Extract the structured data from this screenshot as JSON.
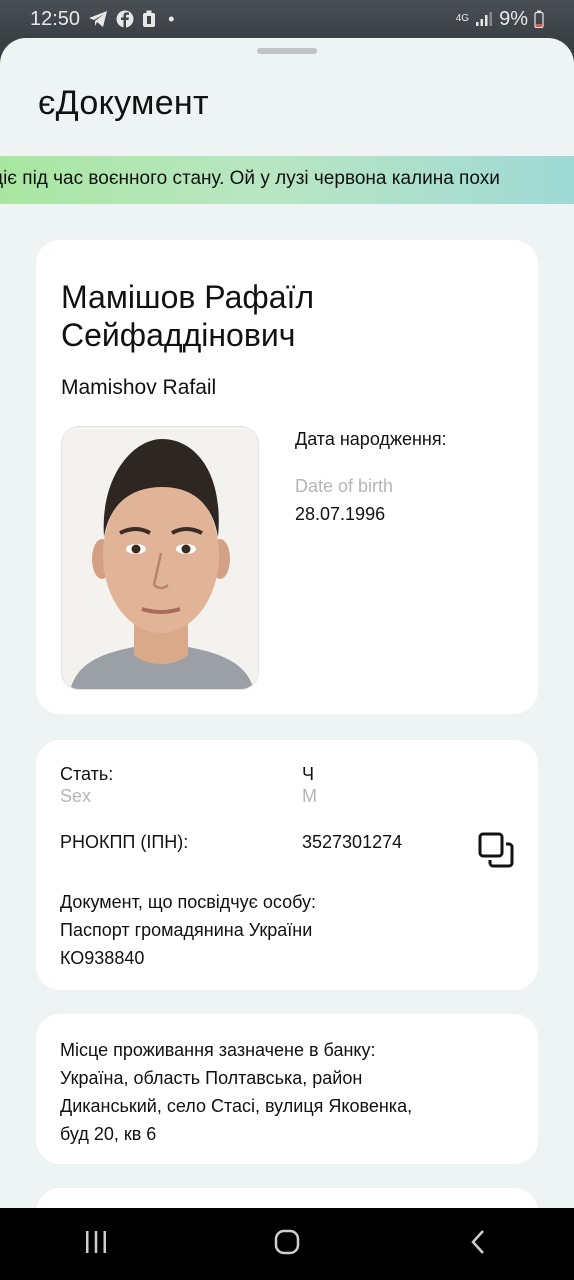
{
  "status": {
    "time": "12:50",
    "network": "4G",
    "battery": "9%"
  },
  "app": {
    "title": "єДокумент"
  },
  "ticker": {
    "text": "діє під час воєнного стану. Ой у лузі червона калина похи"
  },
  "person": {
    "name_ua": "Мамішов Рафаїл Сейфаддінович",
    "name_en": "Mamishov Rafail",
    "dob_label": "Дата народження:",
    "dob_label_en": "Date of birth",
    "dob_value": "28.07.1996"
  },
  "info": {
    "sex_label": "Стать:",
    "sex_label_en": "Sex",
    "sex_value": "Ч",
    "sex_value_en": "M",
    "tax_label": "РНОКПП (ІПН):",
    "tax_value": "3527301274",
    "doc_label": "Документ, що посвідчує особу:",
    "doc_type": "Паспорт громадянина України",
    "doc_number": "КО938840"
  },
  "address": {
    "label": "Місце проживання зазначене в банку:",
    "line1": "Україна, область Полтавська, район",
    "line2": "Диканський, село Стасі, вулиця Яковенка,",
    "line3": "буд 20, кв 6"
  },
  "icons": {
    "status": [
      "telegram-icon",
      "facebook-icon",
      "battery-saver-icon",
      "signal-icon",
      "battery-icon"
    ],
    "copy": "copy-icon",
    "nav": [
      "recents-icon",
      "home-icon",
      "back-icon"
    ]
  },
  "colors": {
    "sheet_bg": "#eef3f4",
    "card_bg": "#ffffff",
    "ticker_start": "#a8e6a0",
    "ticker_end": "#9fd9d6",
    "secondary_text": "#b3b6b9"
  }
}
